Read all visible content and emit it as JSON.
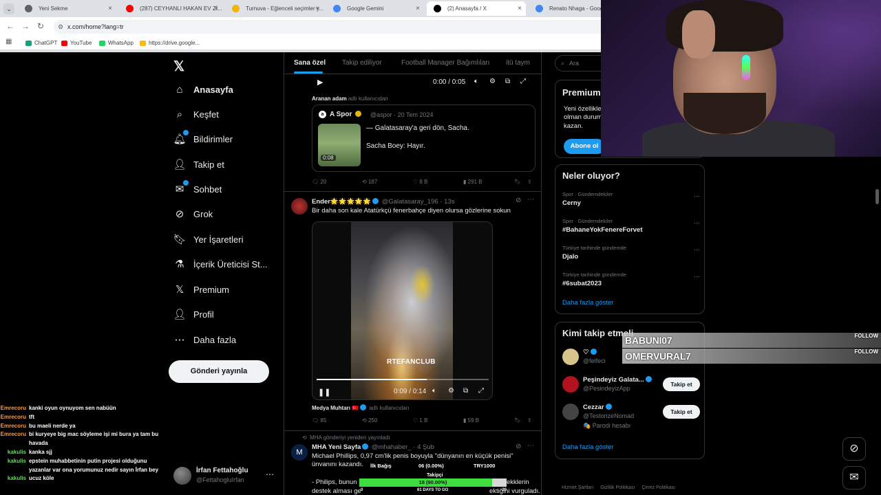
{
  "browser": {
    "tabs": [
      {
        "title": "Yeni Sekme",
        "fav_color": "#5f6368"
      },
      {
        "title": "(287) CEYHANLI HAKAN EV Zİ...",
        "fav_color": "#ff0000"
      },
      {
        "title": "Turnuva - Eğlenceli seçimler y...",
        "fav_color": "#f4b400"
      },
      {
        "title": "Google Gemini",
        "fav_color": "#4285f4"
      },
      {
        "title": "(2) Anasayfa / X",
        "fav_color": "#000000"
      },
      {
        "title": "Renato Nhaga - Google'd",
        "fav_color": "#4285f4"
      }
    ],
    "url": "x.com/home?lang=tr",
    "bookmarks": [
      {
        "label": "ChatGPT",
        "color": "#10a37f"
      },
      {
        "label": "YouTube",
        "color": "#ff0000"
      },
      {
        "label": "WhatsApp",
        "color": "#25d366"
      },
      {
        "label": "https://drive.google...",
        "color": "#fbbc04"
      }
    ]
  },
  "sidebar": {
    "items": [
      {
        "label": "Anasayfa",
        "icon": "home-icon",
        "glyph": "⌂"
      },
      {
        "label": "Keşfet",
        "icon": "search-icon",
        "glyph": "⌕"
      },
      {
        "label": "Bildirimler",
        "icon": "bell-icon",
        "glyph": "🔔︎"
      },
      {
        "label": "Takip et",
        "icon": "person-plus-icon",
        "glyph": "👤︎"
      },
      {
        "label": "Sohbet",
        "icon": "mail-icon",
        "glyph": "✉"
      },
      {
        "label": "Grok",
        "icon": "grok-icon",
        "glyph": "⊘"
      },
      {
        "label": "Yer İşaretleri",
        "icon": "bookmark-icon",
        "glyph": "🔖︎"
      },
      {
        "label": "İçerik Üreticisi St...",
        "icon": "flask-icon",
        "glyph": "⚗"
      },
      {
        "label": "Premium",
        "icon": "x-premium-icon",
        "glyph": "𝕏"
      },
      {
        "label": "Profil",
        "icon": "profile-icon",
        "glyph": "👤︎"
      },
      {
        "label": "Daha fazla",
        "icon": "more-circle-icon",
        "glyph": "⋯"
      }
    ],
    "post_button": "Gönderi yayınla",
    "profile": {
      "name": "İrfan Fettahoğlu",
      "handle": "@FettahogluIrfan"
    }
  },
  "chat": [
    {
      "user": "Emrecoru",
      "msg": "kanki oyun oynuyom sen nabüün",
      "color": "#ff9b3d"
    },
    {
      "user": "Emrecoru",
      "msg": "tft",
      "color": "#ff9b3d"
    },
    {
      "user": "Emrecoru",
      "msg": "bu maeli nerde ya",
      "color": "#ff9b3d"
    },
    {
      "user": "Emrecoru",
      "msg": "bi kuryeye big mac söyleme işi mi bura ya tam bu havada",
      "color": "#ff9b3d"
    },
    {
      "user": "kakulis",
      "msg": "kanka sjj",
      "color": "#6fd36f"
    },
    {
      "user": "kakulis",
      "msg": "epstein muhabbetinin putin projesi olduğunu yazanlar var ona yorumunuz nedir sayın İrfan bey",
      "color": "#6fd36f"
    },
    {
      "user": "kakulis",
      "msg": "ucuz köle",
      "color": "#6fd36f"
    }
  ],
  "feed": {
    "tabs": [
      "Sana özel",
      "Takip ediliyor",
      "Football Manager Bağımlıları",
      "itü taym"
    ],
    "top_video_time": "0:00 / 0:05",
    "searched_note": {
      "bold": "Aranan adam",
      "rest": "adlı kullanıcıdan"
    },
    "quote": {
      "name": "A Spor",
      "handle": "@aspor · 20 Tem 2024",
      "line1": "— Galatasaray'a geri dön, Sacha.",
      "line2": "Sacha Boey: Hayır.",
      "duration": "0:08"
    },
    "post1_stats": {
      "replies": "20",
      "reposts": "187",
      "likes": "8 B",
      "views": "291 B"
    },
    "post2": {
      "name": "Ender🌟🌟🌟🌟🌟",
      "handle": "@Galatasaray_196 · 13s",
      "text": "Bir daha son kale Atatürkçü fenerbahçe diyen olursa gözlerine sokun",
      "watermark": "RTEFANCLUB",
      "time": "0:09 / 0:14",
      "progress": 0.64,
      "note_bold": "Medya Muhtarı",
      "note_rest": "adlı kullanıcıdan",
      "stats": {
        "replies": "85",
        "reposts": "250",
        "likes": "1 B",
        "views": "59 B"
      }
    },
    "post3": {
      "repost_note": "MHA gönderiyi yeniden yayınladı",
      "name": "MHA Yeni Sayfa",
      "handle": "@mhahaber_ · 4 Şub",
      "text1": "Michael Phillips, 0,97 cm'lik penis boyuyla \"dünyanın en küçük penisi\" ünvanını kazandı.",
      "text2a": "- Philips, bunun",
      "text2b": "ekklerin",
      "text3a": "destek alması ge",
      "text3b": "ektiğini vurguladı."
    }
  },
  "right": {
    "search_placeholder": "Ara",
    "premium": {
      "title": "Premium",
      "text": "Yeni özellikle olman durum kazan.",
      "button": "Abone ol"
    },
    "trends_title": "Neler oluyor?",
    "trends": [
      {
        "cat": "Spor · Gündemdekiler",
        "name": "Cerny"
      },
      {
        "cat": "Spor · Gündemdekiler",
        "name": "#BahaneYokFenereForvet"
      },
      {
        "cat": "Türkiye tarihinde gündemde",
        "name": "Djalo"
      },
      {
        "cat": "Türkiye tarihinde gündemde",
        "name": "#6subat2023"
      }
    ],
    "trends_more": "Daha fazla göster",
    "who_title": "Kimi takip etmeli",
    "who": [
      {
        "name": "♡",
        "handle": "@felfeci",
        "extra": "",
        "button": "",
        "color": "#d8c48a"
      },
      {
        "name": "Peşindeyiz Galata...",
        "handle": "@PesindeyizApp",
        "extra": "",
        "button": "Takip et",
        "color": "#b3121f"
      },
      {
        "name": "Cezzar",
        "handle": "@TestorizeNomad",
        "extra": "🎭 Parodi hesabı",
        "button": "Takip et",
        "color": "#444444"
      }
    ],
    "who_more": "Daha fazla göster",
    "footer": [
      "Hizmet Şartları",
      "Gizlilik Politikası",
      "Çerez Politikası"
    ]
  },
  "overlay": {
    "alerts": [
      {
        "user": "BABUNI07",
        "tag": "FOLLOW"
      },
      {
        "user": "OMERVURAL7",
        "tag": "FOLLOW"
      }
    ],
    "goal": {
      "left": "İlk Bağış",
      "mid": "06 (0.00%)",
      "right": "TRY1000",
      "title": "Takipçi",
      "value": "18 (90.00%)",
      "progress": 0.9,
      "start": "0",
      "days": "61 DAYS TO GO",
      "end": "20"
    }
  }
}
